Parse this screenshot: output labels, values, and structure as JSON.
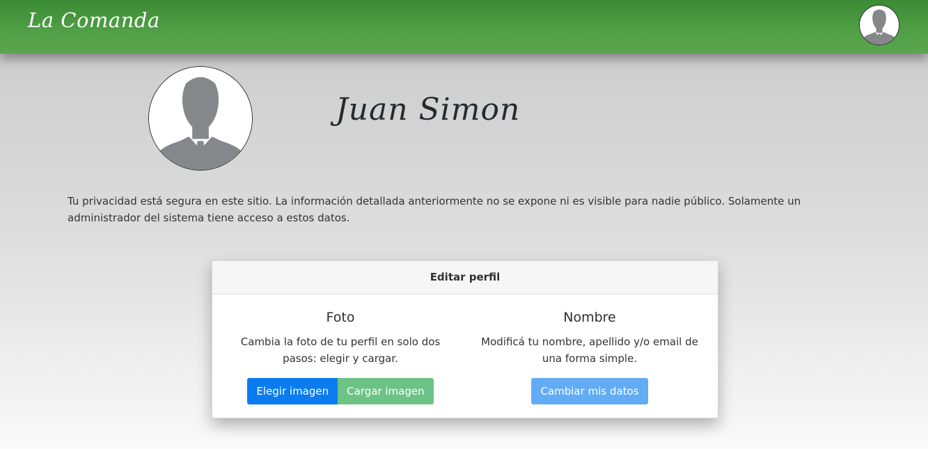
{
  "navbar": {
    "brand": "La Comanda",
    "avatar_icon": "user-silhouette-icon"
  },
  "profile": {
    "name": "Juan Simon",
    "avatar_icon": "user-silhouette-icon",
    "privacy_text": "Tu privacidad está segura en este sitio. La información detallada anteriormente no se expone ni es visible para nadie público. Solamente un administrador del sistema tiene acceso a estos datos."
  },
  "edit_card": {
    "title": "Editar perfil",
    "photo": {
      "title": "Foto",
      "description": "Cambia la foto de tu perfil en solo dos pasos: elegir y cargar.",
      "choose_button": "Elegir imagen",
      "upload_button": "Cargar imagen"
    },
    "name_section": {
      "title": "Nombre",
      "description": "Modificá tu nombre, apellido y/o email de una forma simple.",
      "change_button": "Cambiar mis datos"
    }
  },
  "colors": {
    "navbar_green": "#4f9f45",
    "primary_blue": "#0a7cf0",
    "success_green": "#6dc285",
    "info_blue": "#62acf6"
  }
}
